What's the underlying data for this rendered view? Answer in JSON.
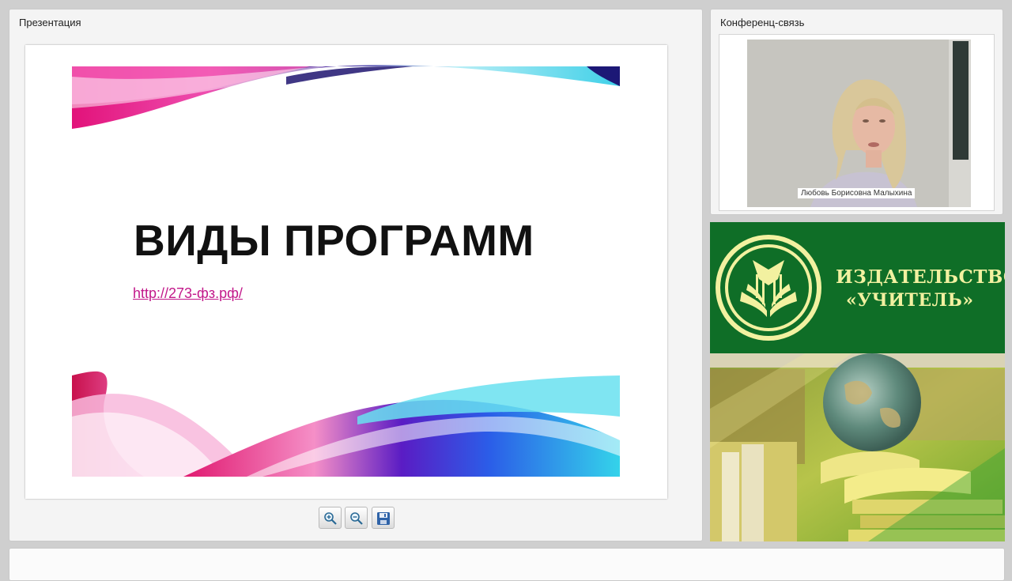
{
  "presentation_panel": {
    "title": "Презентация",
    "slide": {
      "heading": "ВИДЫ ПРОГРАММ",
      "link": "http://273-фз.рф/"
    },
    "toolbar": {
      "zoom_in_icon": "zoom-in-icon",
      "zoom_out_icon": "zoom-out-icon",
      "save_icon": "floppy-disk-icon"
    }
  },
  "conference_panel": {
    "title": "Конференц-связь",
    "participant_name": "Любовь Борисовна Малыхина"
  },
  "ad_panel": {
    "publisher_line1": "ИЗДАТЕЛЬСТВО",
    "publisher_line2": "«УЧИТЕЛЬ»",
    "colors": {
      "background": "#0f6e27",
      "text": "#f2f1a0"
    }
  }
}
